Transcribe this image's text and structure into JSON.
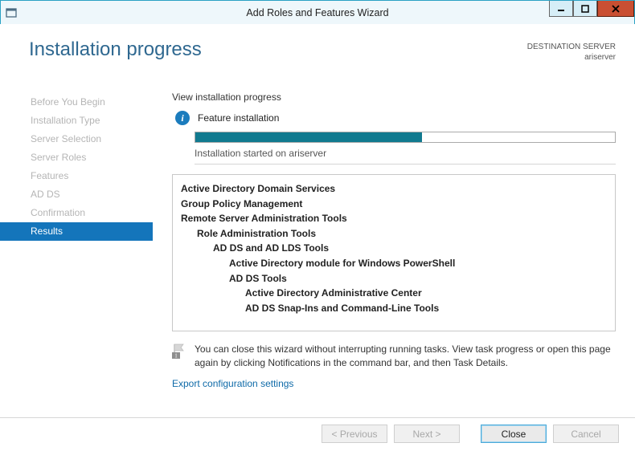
{
  "window": {
    "title": "Add Roles and Features Wizard"
  },
  "header": {
    "heading": "Installation progress",
    "destination_label": "DESTINATION SERVER",
    "destination_server": "ariserver"
  },
  "sidebar": {
    "steps": [
      "Before You Begin",
      "Installation Type",
      "Server Selection",
      "Server Roles",
      "Features",
      "AD DS",
      "Confirmation",
      "Results"
    ],
    "selected_index": 7
  },
  "main": {
    "view_label": "View installation progress",
    "status_title": "Feature installation",
    "progress_percent": 54,
    "substatus": "Installation started on ariserver",
    "tree": [
      {
        "text": "Active Directory Domain Services",
        "indent": 0,
        "bold": true
      },
      {
        "text": "Group Policy Management",
        "indent": 0,
        "bold": true
      },
      {
        "text": "Remote Server Administration Tools",
        "indent": 0,
        "bold": true
      },
      {
        "text": "Role Administration Tools",
        "indent": 1,
        "bold": true
      },
      {
        "text": "AD DS and AD LDS Tools",
        "indent": 2,
        "bold": true
      },
      {
        "text": "Active Directory module for Windows PowerShell",
        "indent": 3,
        "bold": true
      },
      {
        "text": "AD DS Tools",
        "indent": 3,
        "bold": true
      },
      {
        "text": "Active Directory Administrative Center",
        "indent": 4,
        "bold": true
      },
      {
        "text": "AD DS Snap-Ins and Command-Line Tools",
        "indent": 4,
        "bold": true
      }
    ],
    "note": "You can close this wizard without interrupting running tasks. View task progress or open this page again by clicking Notifications in the command bar, and then Task Details.",
    "export_link": "Export configuration settings"
  },
  "footer": {
    "previous": "< Previous",
    "next": "Next >",
    "close": "Close",
    "cancel": "Cancel"
  }
}
